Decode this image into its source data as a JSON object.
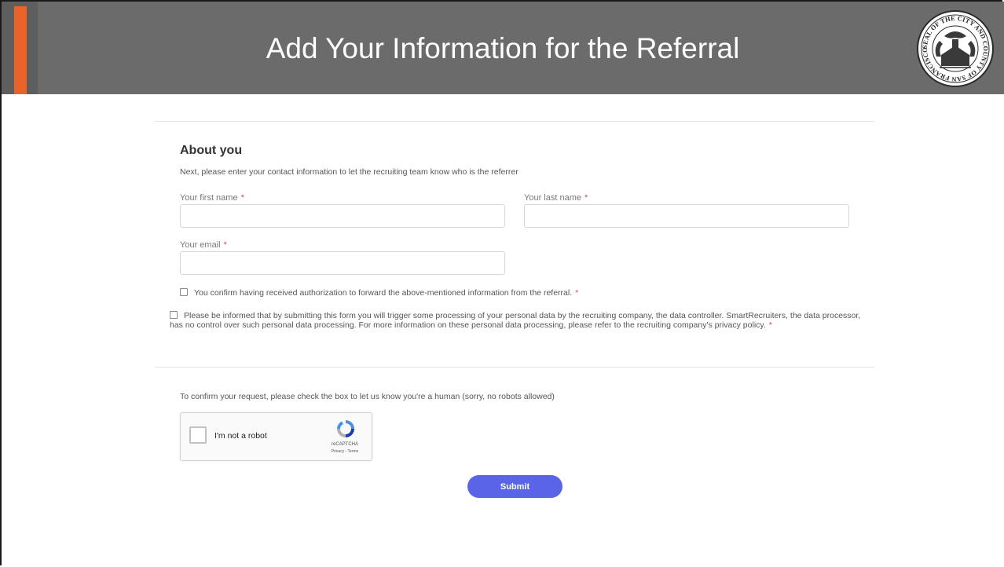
{
  "header": {
    "title": "Add Your Information for the Referral",
    "seal_text": "SEAL OF THE CITY AND COUNTY OF SAN FRANCISCO",
    "accent_color": "#e8622a",
    "band_color": "#6b6b6b"
  },
  "form": {
    "heading": "About you",
    "description": "Next, please enter your contact information to let the recruiting team know who is the referrer",
    "required_marker": "*",
    "first_name": {
      "label": "Your first name",
      "value": ""
    },
    "last_name": {
      "label": "Your last name",
      "value": ""
    },
    "email": {
      "label": "Your email",
      "value": ""
    },
    "authorization_check": {
      "label": "You confirm having received authorization to forward the above-mentioned information from the referral.",
      "checked": false
    },
    "consent_check": {
      "label": "Please be informed that by submitting this form you will trigger some processing of your personal data by the recruiting company, the data controller. SmartRecruiters, the data processor, has no control over such personal data processing. For more information on these personal data processing, please refer to the recruiting company's privacy policy.",
      "checked": false
    }
  },
  "captcha": {
    "note": "To confirm your request, please check the box to let us know you're a human (sorry, no robots allowed)",
    "label": "I'm not a robot",
    "brand": "reCAPTCHA",
    "terms": "Privacy - Terms",
    "checked": false
  },
  "submit_label": "Submit",
  "submit_color": "#5a64e8"
}
